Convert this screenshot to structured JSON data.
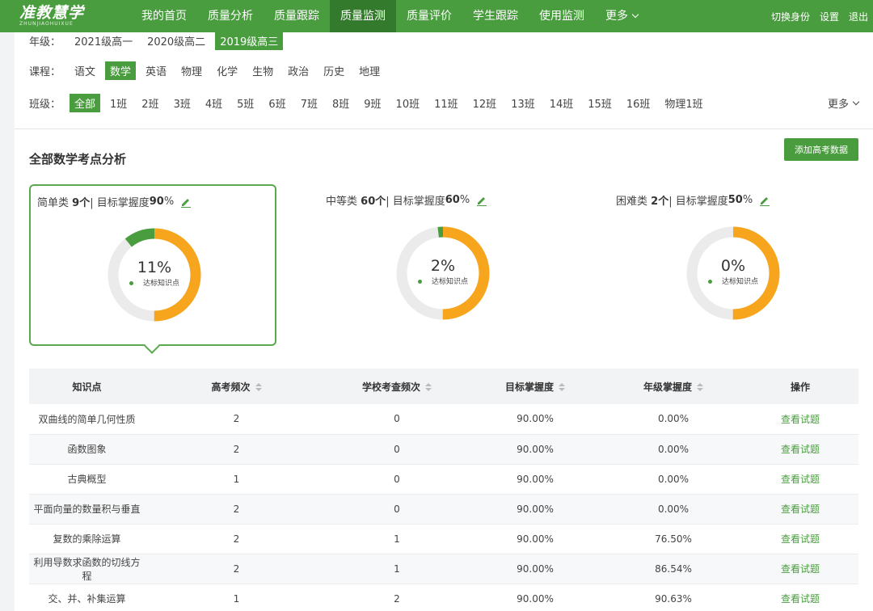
{
  "app": {
    "logo": "准教慧学",
    "logo_sub": "ZHUNJIAOHUIXUE",
    "nav": [
      "我的首页",
      "质量分析",
      "质量跟踪",
      "质量监测",
      "质量评价",
      "学生跟踪",
      "使用监测"
    ],
    "nav_active_index": 3,
    "nav_more": "更多",
    "top_right": {
      "switch_identity": "切换身份",
      "settings": "设置",
      "logout": "退出"
    }
  },
  "filters": {
    "grade_label": "年级：",
    "grades": [
      "2021级高一",
      "2020级高二",
      "2019级高三"
    ],
    "grade_active": 2,
    "course_label": "课程：",
    "courses": [
      "语文",
      "数学",
      "英语",
      "物理",
      "化学",
      "生物",
      "政治",
      "历史",
      "地理"
    ],
    "course_active": 1,
    "class_label": "班级：",
    "classes": [
      "全部",
      "1班",
      "2班",
      "3班",
      "4班",
      "5班",
      "6班",
      "7班",
      "8班",
      "9班",
      "10班",
      "11班",
      "12班",
      "13班",
      "14班",
      "15班",
      "16班",
      "物理1班"
    ],
    "class_active": 0,
    "more": "更多"
  },
  "main": {
    "title": "全部数学考点分析",
    "add_button": "添加高考数据",
    "cards": [
      {
        "category": "简单类",
        "count": "9个",
        "sep": " | 目标掌握度 ",
        "target": "90",
        "unit": " %",
        "percent": "11%",
        "legend": "达标知识点",
        "achieved_fraction": 0.11
      },
      {
        "category": "中等类",
        "count": "60个",
        "sep": " | 目标掌握度 ",
        "target": "60",
        "unit": " %",
        "percent": "2%",
        "legend": "达标知识点",
        "achieved_fraction": 0.02
      },
      {
        "category": "困难类",
        "count": "2个",
        "sep": " | 目标掌握度 ",
        "target": "50",
        "unit": " %",
        "percent": "0%",
        "legend": "达标知识点",
        "achieved_fraction": 0.0
      }
    ],
    "selected_card": 0,
    "colors": {
      "accent": "#4a9d3f",
      "orange": "#f7a51c",
      "ring_bg": "#ebebeb"
    },
    "table": {
      "headers": [
        "知识点",
        "高考频次",
        "学校考查频次",
        "目标掌握度",
        "年级掌握度",
        "操作"
      ],
      "rows": [
        [
          "双曲线的简单几何性质",
          "2",
          "0",
          "90.00%",
          "0.00%",
          "查看试题"
        ],
        [
          "函数图象",
          "2",
          "0",
          "90.00%",
          "0.00%",
          "查看试题"
        ],
        [
          "古典概型",
          "1",
          "0",
          "90.00%",
          "0.00%",
          "查看试题"
        ],
        [
          "平面向量的数量积与垂直",
          "2",
          "0",
          "90.00%",
          "0.00%",
          "查看试题"
        ],
        [
          "复数的乘除运算",
          "2",
          "1",
          "90.00%",
          "76.50%",
          "查看试题"
        ],
        [
          "利用导数求函数的切线方程",
          "2",
          "1",
          "90.00%",
          "86.54%",
          "查看试题"
        ],
        [
          "交、并、补集运算",
          "1",
          "2",
          "90.00%",
          "90.63%",
          "查看试题"
        ]
      ]
    }
  }
}
